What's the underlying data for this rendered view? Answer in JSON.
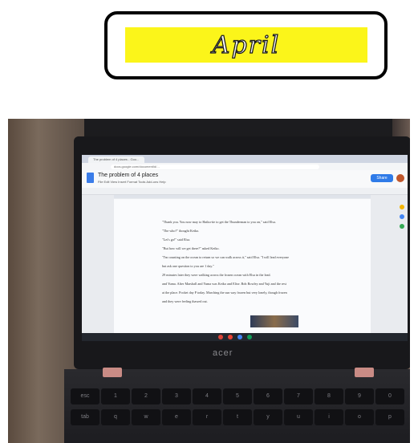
{
  "badge": {
    "text": "April"
  },
  "screen": {
    "tab_title": "The problem of 4 places - Goo...",
    "url": "docs.google.com/document/d/...",
    "doc_title": "The problem of 4 places",
    "menu": "File  Edit  View  Insert  Format  Tools  Add-ons  Help",
    "share_label": "Share",
    "lines": [
      "\"Thank you. You now may to Haiku-tie to get the Thunderman to you on,\" said Elsa.",
      "\"The who?\" thought Keiko.",
      "\"Let's go!\" said Elsa.",
      "\"But how will we get there?\" asked Keiko.",
      "\"I'm counting on the ocean to return so we can walk across it,\" said Elsa. \"I will lead everyone",
      "but ask one question to you are 1 day.\"",
      "29 minutes later they were walking across the frozen ocean with Elsa in the lead.",
      "and Yuma. After Marshall and Yuma was Keiko and Elise. Bob Rowley and Yuji and the rest",
      "at the place. Pocket day P today. Marching the sun way frozen but very lonely, though frozen",
      "and they were feeling thawed out."
    ]
  },
  "laptop": {
    "brand": "acer"
  },
  "keyboard": {
    "row1": [
      "esc",
      "1",
      "2",
      "3",
      "4",
      "5",
      "6",
      "7",
      "8",
      "9",
      "0"
    ],
    "row2": [
      "tab",
      "q",
      "w",
      "e",
      "r",
      "t",
      "y",
      "u",
      "i",
      "o",
      "p"
    ]
  }
}
